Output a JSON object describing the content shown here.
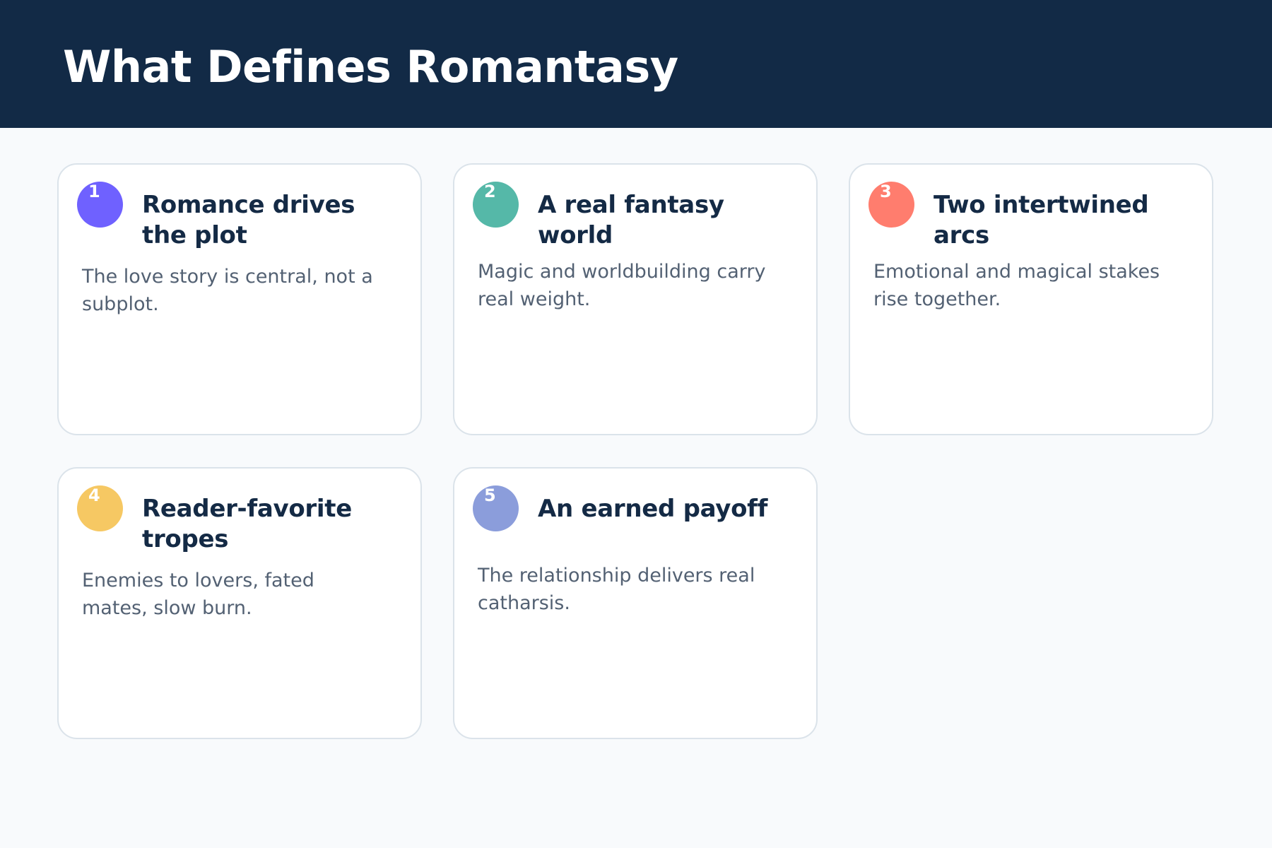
{
  "page": {
    "title": "What Defines Romantasy"
  },
  "cards": [
    {
      "number": "1",
      "title": "Romance drives the plot",
      "description": "The love story is central, not a subplot.",
      "badge_color": "#6f61ff"
    },
    {
      "number": "2",
      "title": "A real fantasy world",
      "description": "Magic and worldbuilding carry real weight.",
      "badge_color": "#55b8a8"
    },
    {
      "number": "3",
      "title": "Two intertwined arcs",
      "description": "Emotional and magical stakes rise together.",
      "badge_color": "#ff7d6e"
    },
    {
      "number": "4",
      "title": "Reader-favorite tropes",
      "description": "Enemies to lovers, fated mates, slow burn.",
      "badge_color": "#f6c863"
    },
    {
      "number": "5",
      "title": "An earned payoff",
      "description": "The relationship delivers real catharsis.",
      "badge_color": "#8b9ddb"
    }
  ]
}
